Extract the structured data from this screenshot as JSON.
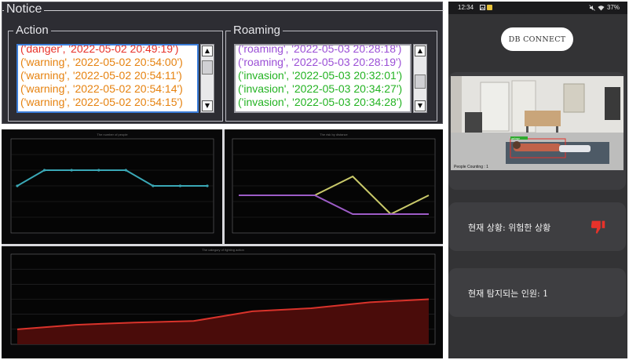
{
  "notice": {
    "title": "Notice",
    "action": {
      "title": "Action",
      "logs": [
        {
          "text": "('danger', '2022-05-02 20:49:19')",
          "color": "#e8322a"
        },
        {
          "text": "('warning', '2022-05-02 20:54:00')",
          "color": "#e6820f"
        },
        {
          "text": "('warning', '2022-05-02 20:54:11')",
          "color": "#e6820f"
        },
        {
          "text": "('warning', '2022-05-02 20:54:14')",
          "color": "#e6820f"
        },
        {
          "text": "('warning', '2022-05-02 20:54:15')",
          "color": "#e6820f"
        }
      ]
    },
    "roaming": {
      "title": "Roaming",
      "logs": [
        {
          "text": "('roaming', '2022-05-03 20:28:18')",
          "color": "#9b4fd6"
        },
        {
          "text": "('roaming', '2022-05-03 20:28:19')",
          "color": "#9b4fd6"
        },
        {
          "text": "('invasion', '2022-05-03 20:32:01')",
          "color": "#24b323"
        },
        {
          "text": "('invasion', '2022-05-03 20:34:27')",
          "color": "#24b323"
        },
        {
          "text": "('invasion', '2022-05-03 20:34:28')",
          "color": "#24b323"
        }
      ]
    }
  },
  "chart_data": [
    {
      "type": "line",
      "title": "The number of people",
      "x": [
        0,
        1,
        2,
        3,
        4,
        5,
        6,
        7
      ],
      "series": [
        {
          "values": [
            3,
            4,
            4,
            4,
            4,
            3,
            3,
            3
          ],
          "color": "#3aa8b6"
        }
      ],
      "ylim": [
        0,
        6
      ]
    },
    {
      "type": "line",
      "title": "The risk by distance",
      "x": [
        0,
        1,
        2,
        3,
        4,
        5
      ],
      "series": [
        {
          "values": [
            2,
            2,
            2,
            3,
            1,
            2
          ],
          "color": "#c9c96a"
        },
        {
          "values": [
            2,
            2,
            2,
            1,
            1,
            1
          ],
          "color": "#9d5cc7"
        }
      ],
      "ylim": [
        0,
        5
      ]
    },
    {
      "type": "area",
      "title": "The category of fighting action",
      "x": [
        0,
        1,
        2,
        3,
        4,
        5,
        6,
        7
      ],
      "series": [
        {
          "values": [
            1.0,
            1.3,
            1.45,
            1.55,
            2.2,
            2.4,
            2.8,
            3.0
          ],
          "color": "#d9332b"
        }
      ],
      "ylim": [
        0,
        6
      ]
    }
  ],
  "phone": {
    "statusbar": {
      "time": "12:34",
      "battery": "37%"
    },
    "db_button": "DB CONNECT",
    "camera_caption": "People Counting : 1",
    "detect_label": "garbage",
    "status_text": "현재 상황:  위험한 상황",
    "count_text": "현재 탐지되는 인원:  1",
    "colors": {
      "thumb": "#e8322a"
    }
  }
}
